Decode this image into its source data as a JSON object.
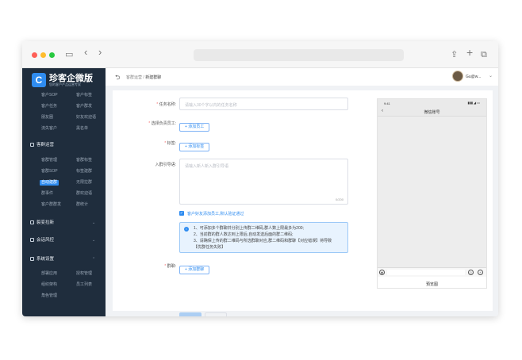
{
  "browser": {
    "back_glyph": "‹",
    "forward_glyph": "›",
    "share_glyph": "⇪",
    "plus_glyph": "+",
    "tabs_glyph": "⧉"
  },
  "sidebar": {
    "logo_mark": "C",
    "logo_title": "珍客企微版",
    "logo_sub": "您的客户产品运营专家",
    "top_rows": [
      [
        "客户SOP",
        "客户标签"
      ],
      [
        "客户任务",
        "客户群发"
      ],
      [
        "朋友圈",
        "好友欢迎语"
      ],
      [
        "流失客户",
        "黑名单"
      ]
    ],
    "group_community": "客群运营",
    "community_rows": [
      [
        "客群管理",
        "客群标签"
      ],
      [
        "客群SOP",
        "标签建群"
      ],
      [
        "自动建群",
        "无限拉群"
      ],
      [
        "群事件",
        "群欢迎语"
      ],
      [
        "客户群群发",
        "群统计"
      ]
    ],
    "group_funnel": "裂变拉新",
    "group_risk": "会话风控",
    "group_settings": "系统设置",
    "settings_rows": [
      [
        "部署应用",
        "授权管理"
      ],
      [
        "组织架构",
        "员工列表"
      ],
      [
        "角色管理",
        ""
      ]
    ]
  },
  "topbar": {
    "back_glyph": "⮌",
    "crumb_parent": "客群运营",
    "crumb_sep": " / ",
    "crumb_current": "新建群聊",
    "user_name": "Gu@w...",
    "caret": "⌄"
  },
  "form": {
    "task_name_label": "任务名称:",
    "task_name_placeholder": "请输入30个字以内的任务名称",
    "owner_label": "选择负责员工:",
    "add_staff": "+ 添加员工",
    "tag_label": "标签:",
    "add_tag": "+ 添加标签",
    "greeting_label": "入群引导语:",
    "greeting_placeholder": "请输入新人新入群引导语",
    "greeting_counter": "0/200",
    "auto_accept_label": "客户好友添加员工,默认验证通过",
    "info_lines": [
      "1、可添加多个群聊并分别上传群二维码,群人数上限最多为200;",
      "2、当前群的群人数达到上限后,自动发送后面的群二维码;",
      "3、请确保上传的群二维码与所选群聊对应,群二维码和群聊【对应错误】将导致",
      "【优群任务失败】"
    ],
    "group_label": "群聊:",
    "add_group": "+ 添加群聊"
  },
  "phone": {
    "time": "9:41",
    "signal": "▮▮▮ ◢ ▭",
    "back": "‹",
    "title": "微信账号",
    "caption": "預览图"
  },
  "colors": {
    "accent": "#2f8cf0",
    "sidebar_bg": "#1f2d3d"
  }
}
